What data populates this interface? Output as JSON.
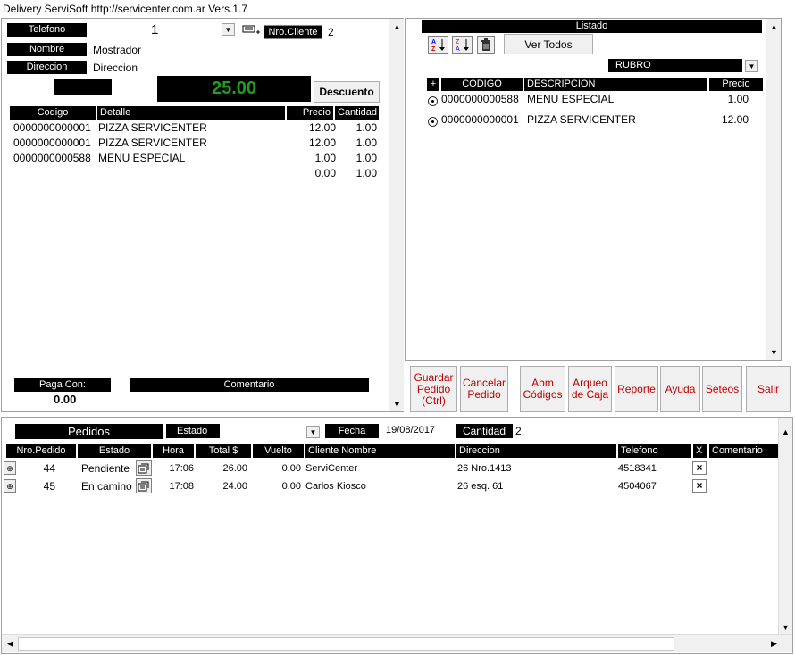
{
  "window": {
    "title": "Delivery ServiSoft http://servicenter.com.ar Vers.1.7"
  },
  "order": {
    "telefono_label": "Telefono",
    "telefono_value": "1",
    "nro_cliente_label": "Nro.Cliente",
    "nro_cliente_value": "2",
    "nombre_label": "Nombre",
    "nombre_value": "Mostrador",
    "direccion_label": "Direccion",
    "direccion_value": "Direccion",
    "total": "25.00",
    "total_color": "#1f9e1f",
    "descuento_label": "Descuento",
    "columns": [
      "Codigo",
      "Detalle",
      "Precio",
      "Cantidad"
    ],
    "items": [
      {
        "codigo": "0000000000001",
        "detalle": "PIZZA SERVICENTER",
        "precio": "12.00",
        "cantidad": "1.00"
      },
      {
        "codigo": "0000000000001",
        "detalle": "PIZZA SERVICENTER",
        "precio": "12.00",
        "cantidad": "1.00"
      },
      {
        "codigo": "0000000000588",
        "detalle": "MENU ESPECIAL",
        "precio": "1.00",
        "cantidad": "1.00"
      },
      {
        "codigo": "",
        "detalle": "",
        "precio": "0.00",
        "cantidad": "1.00"
      }
    ],
    "paga_con_label": "Paga Con:",
    "paga_con_value": "0.00",
    "comentario_label": "Comentario"
  },
  "listado": {
    "title": "Listado",
    "ver_todos": "Ver Todos",
    "rubro_label": "RUBRO",
    "columns": [
      "+",
      "CODIGO",
      "DESCRIPCION",
      "Precio"
    ],
    "items": [
      {
        "codigo": "0000000000588",
        "descripcion": "MENU ESPECIAL",
        "precio": "1.00"
      },
      {
        "codigo": "0000000000001",
        "descripcion": "PIZZA SERVICENTER",
        "precio": "12.00"
      }
    ]
  },
  "actions": {
    "guardar": "Guardar Pedido (Ctrl)",
    "cancelar": "Cancelar Pedido",
    "abm": "Abm Códigos",
    "arqueo": "Arqueo de Caja",
    "reporte": "Reporte",
    "ayuda": "Ayuda",
    "seteos": "Seteos",
    "salir": "Salir",
    "label_color": "#c00000"
  },
  "pedidos": {
    "title": "Pedidos",
    "estado_label": "Estado",
    "fecha_label": "Fecha",
    "fecha_value": "19/08/2017",
    "cantidad_label": "Cantidad",
    "cantidad_value": "2",
    "columns": [
      "Nro.Pedido",
      "Estado",
      "Hora",
      "Total $",
      "Vuelto",
      "Cliente Nombre",
      "Direccion",
      "Telefono",
      "X",
      "Comentario"
    ],
    "rows": [
      {
        "nro": "44",
        "estado": "Pendiente",
        "hora": "17:06",
        "total": "26.00",
        "vuelto": "0.00",
        "cliente": "ServiCenter",
        "direccion": "26 Nro.1413",
        "telefono": "4518341"
      },
      {
        "nro": "45",
        "estado": "En camino",
        "hora": "17:08",
        "total": "24.00",
        "vuelto": "0.00",
        "cliente": "Carlos Kiosco",
        "direccion": "26 esq. 61",
        "telefono": "4504067"
      }
    ]
  }
}
